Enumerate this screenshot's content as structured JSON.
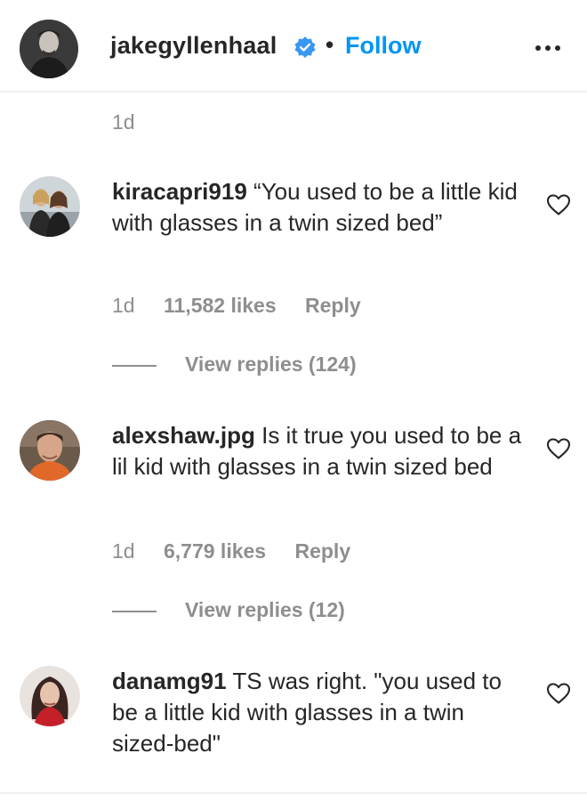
{
  "header": {
    "username": "jakegyllenhaal",
    "separator": "•",
    "follow_label": "Follow"
  },
  "top_time": "1d",
  "comments": [
    {
      "username": "kiracapri919",
      "text": "“You used to be a little kid with glasses in a twin sized bed”",
      "time": "1d",
      "likes": "11,582 likes",
      "reply_label": "Reply",
      "view_replies": "View replies (124)"
    },
    {
      "username": "alexshaw.jpg",
      "text": "Is it true you used to be a lil kid with glasses in a twin sized bed",
      "time": "1d",
      "likes": "6,779 likes",
      "reply_label": "Reply",
      "view_replies": "View replies (12)"
    },
    {
      "username": "danamg91",
      "text": "TS was right. \"you used to be a little kid with glasses in a twin sized-bed\""
    }
  ],
  "colors": {
    "accent": "#0095f6",
    "verified": "#3897f0",
    "secondary_text": "#8e8e8e",
    "primary_text": "#262626"
  },
  "icons": {
    "verified": "verified-badge-icon",
    "more": "more-options-icon",
    "like": "heart-icon"
  }
}
